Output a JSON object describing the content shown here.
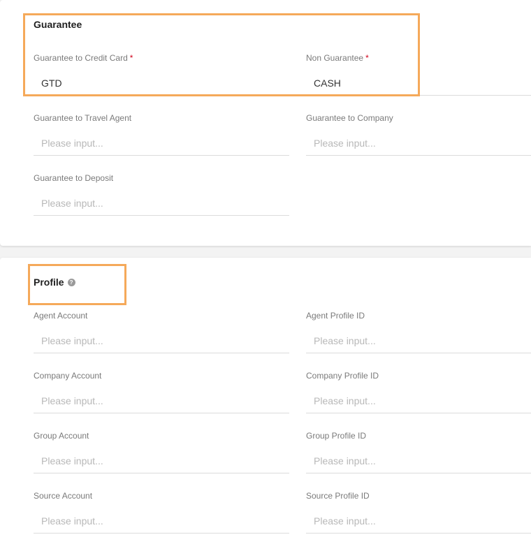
{
  "guarantee": {
    "title": "Guarantee",
    "required_mark": "*",
    "fields": [
      {
        "label": "Guarantee to Credit Card",
        "value": "GTD",
        "placeholder": "",
        "required": true
      },
      {
        "label": "Non Guarantee",
        "value": "CASH",
        "placeholder": "",
        "required": true
      },
      {
        "label": "Guarantee to Travel Agent",
        "value": "",
        "placeholder": "Please input..."
      },
      {
        "label": "Guarantee to Company",
        "value": "",
        "placeholder": "Please input..."
      },
      {
        "label": "Guarantee to Deposit",
        "value": "",
        "placeholder": "Please input..."
      }
    ]
  },
  "profile": {
    "title": "Profile",
    "help_icon": "question-circle-icon",
    "help_glyph": "?",
    "fields": [
      {
        "label": "Agent Account",
        "value": "",
        "placeholder": "Please input..."
      },
      {
        "label": "Agent Profile ID",
        "value": "",
        "placeholder": "Please input..."
      },
      {
        "label": "Company Account",
        "value": "",
        "placeholder": "Please input..."
      },
      {
        "label": "Company Profile ID",
        "value": "",
        "placeholder": "Please input..."
      },
      {
        "label": "Group Account",
        "value": "",
        "placeholder": "Please input..."
      },
      {
        "label": "Group Profile ID",
        "value": "",
        "placeholder": "Please input..."
      },
      {
        "label": "Source Account",
        "value": "",
        "placeholder": "Please input..."
      },
      {
        "label": "Source Profile ID",
        "value": "",
        "placeholder": "Please input..."
      }
    ]
  },
  "colors": {
    "highlight": "#f5a95a",
    "required": "#d0021b",
    "label": "#7a7a7a",
    "placeholder": "#b8b8b8"
  }
}
